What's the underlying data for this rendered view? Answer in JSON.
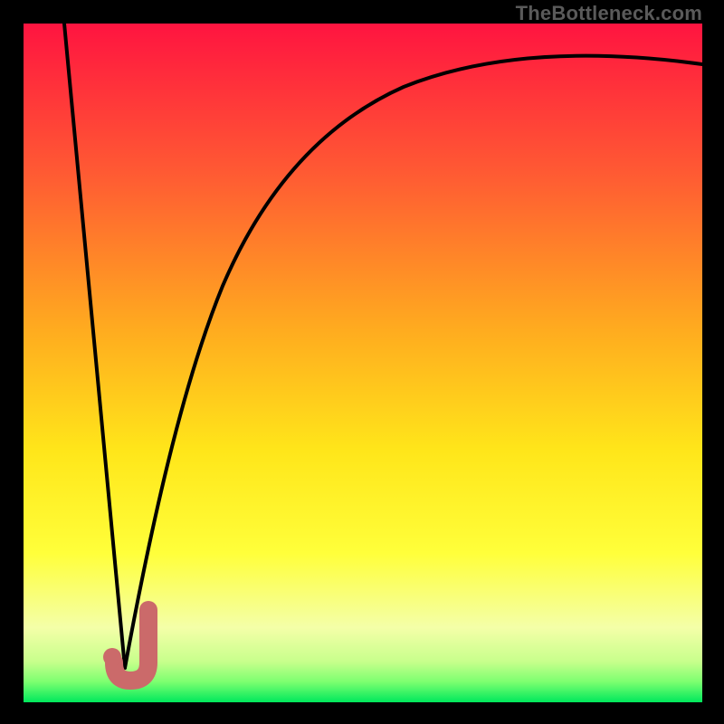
{
  "watermark": "TheBottleneck.com",
  "colors": {
    "frame": "#000000",
    "curve": "#000000",
    "hook": "#cb6a6a",
    "grad_top": "#ff1440",
    "grad_mid1": "#ff7a2a",
    "grad_mid2": "#ffd400",
    "grad_mid3": "#ffff30",
    "grad_low": "#f7ffb0",
    "grad_bottom": "#00e85c"
  },
  "chart_data": {
    "type": "line",
    "title": "",
    "xlabel": "",
    "ylabel": "",
    "xlim": [
      0,
      100
    ],
    "ylim": [
      0,
      100
    ],
    "series": [
      {
        "name": "left-line",
        "x": [
          6,
          15
        ],
        "y": [
          100,
          5
        ]
      },
      {
        "name": "right-curve",
        "x": [
          15,
          18,
          22,
          27,
          33,
          40,
          50,
          62,
          78,
          100
        ],
        "y": [
          5,
          20,
          38,
          53,
          65,
          74,
          82,
          88,
          92,
          94
        ]
      }
    ],
    "annotations": [
      {
        "name": "hook-mark",
        "shape": "J",
        "x": 15.5,
        "y": 5
      }
    ]
  }
}
